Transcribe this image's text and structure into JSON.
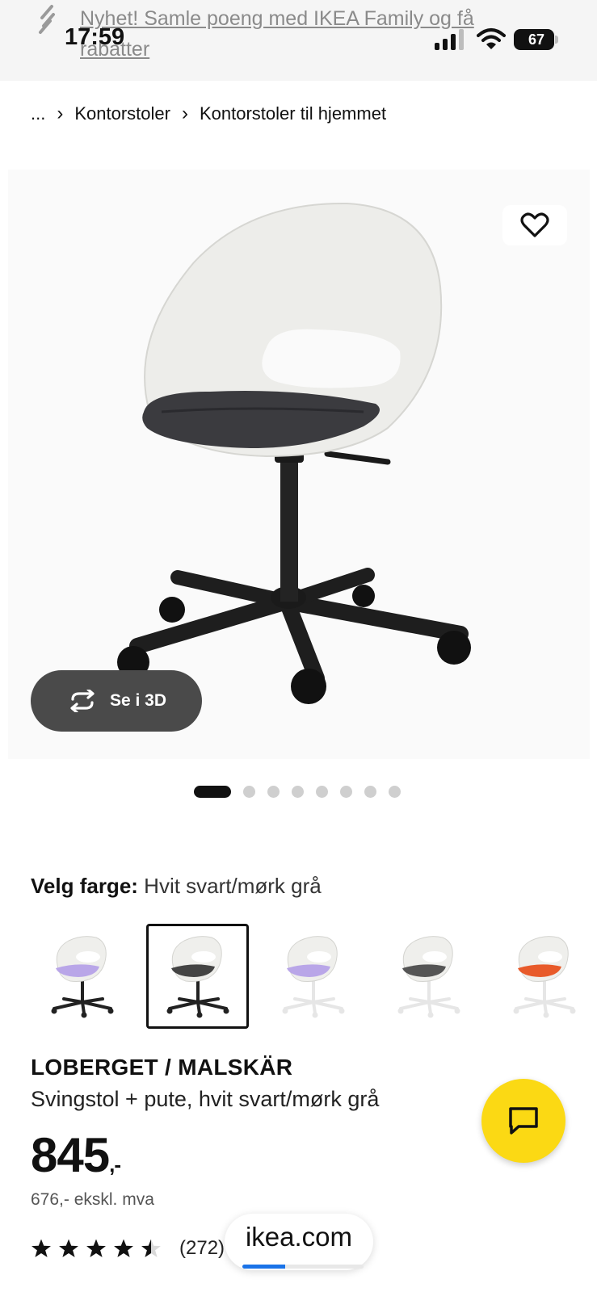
{
  "status_bar": {
    "time": "17:59",
    "battery_level": "67"
  },
  "banner": {
    "text": "Nyhet! Samle poeng med IKEA Family og få rabatter"
  },
  "breadcrumb": {
    "items": [
      "...",
      "Kontorstoler",
      "Kontorstoler til hjemmet"
    ]
  },
  "hero": {
    "view_3d_label": "Se i 3D",
    "image_count": 8,
    "active_image_index": 0
  },
  "color_selection": {
    "label": "Velg farge:",
    "value": "Hvit svart/mørk grå",
    "options": [
      {
        "seat_color": "#b9a6e8",
        "base_color": "#222222"
      },
      {
        "seat_color": "#444444",
        "base_color": "#222222",
        "selected": true
      },
      {
        "seat_color": "#b9a6e8",
        "base_color": "#e6e6e6"
      },
      {
        "seat_color": "#555555",
        "base_color": "#e6e6e6"
      },
      {
        "seat_color": "#e85a2a",
        "base_color": "#e6e6e6"
      }
    ]
  },
  "product": {
    "name": "LOBERGET / MALSKÄR",
    "description": "Svingstol + pute, hvit svart/mørk grå",
    "price": "845",
    "price_suffix": ",-",
    "price_ex_vat": "676,- ekskl. mva",
    "rating": 4.5,
    "review_count": "(272)"
  },
  "browser": {
    "url": "ikea.com",
    "load_progress": 0.35
  },
  "colors": {
    "chat_button": "#fbd914",
    "banner_bg": "#f5f5f5",
    "progress": "#1a73e8"
  },
  "icons": {
    "banner": "link-icon",
    "favourite": "heart-icon",
    "view_3d": "rotate-icon",
    "chat": "chat-bubble-icon",
    "rating": "star-icon"
  }
}
